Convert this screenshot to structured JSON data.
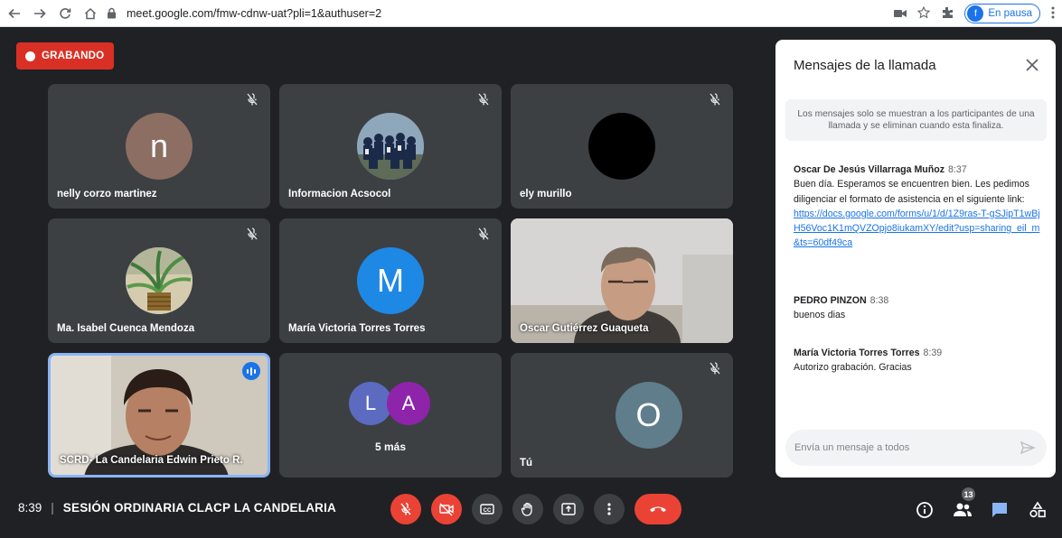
{
  "browser": {
    "url": "meet.google.com/fmw-cdnw-uat?pli=1&authuser=2",
    "profile_initial": "f",
    "profile_status": "En pausa"
  },
  "recording": {
    "label": "GRABANDO"
  },
  "tiles": [
    {
      "name": "nelly corzo martinez",
      "initial": "n",
      "avatar_color": "#8d6e63"
    },
    {
      "name": "Informacion Acsocol"
    },
    {
      "name": "ely murillo"
    },
    {
      "name": "Ma. Isabel Cuenca Mendoza"
    },
    {
      "name": "María Victoria Torres Torres",
      "initial": "M",
      "avatar_color": "#1e88e5"
    },
    {
      "name": "Oscar Gutiérrez Guaqueta"
    },
    {
      "name": "SCRD- La Candelaria Edwin Prieto R."
    },
    {
      "more_label": "5 más",
      "initials": [
        "L",
        "A"
      ]
    },
    {
      "name": "Tú",
      "initial": "O",
      "avatar_color": "#607d8b"
    }
  ],
  "chat": {
    "title": "Mensajes de la llamada",
    "notice": "Los mensajes solo se muestran a los participantes de una llamada y se eliminan cuando esta finaliza.",
    "messages": [
      {
        "sender": "Oscar De Jesús Villarraga Muñoz",
        "time": "8:37",
        "text": "Buen día. Esperamos se encuentren bien. Les pedimos diligenciar el formato de asistencia en el siguiente link:",
        "link": "https://docs.google.com/forms/u/1/d/1Z9ras-T-gSJipT1wBjH56Voc1K1mQVZOpjo8iukamXY/edit?usp=sharing_eil_m&ts=60df49ca"
      },
      {
        "sender": "PEDRO PINZON",
        "time": "8:38",
        "text": "buenos dias"
      },
      {
        "sender": "María Victoria Torres Torres",
        "time": "8:39",
        "text": "Autorizo grabación. Gracias"
      }
    ],
    "input_placeholder": "Envía un mensaje a todos"
  },
  "footer": {
    "time": "8:39",
    "separator": "|",
    "meeting_title": "SESIÓN ORDINARIA CLACP LA CANDELARIA",
    "participants_count": "13"
  },
  "colors": {
    "record_red": "#d93025",
    "control_red": "#ea4335",
    "accent_blue": "#1a73e8",
    "tile_bg": "#3c4043",
    "page_bg": "#202124"
  }
}
